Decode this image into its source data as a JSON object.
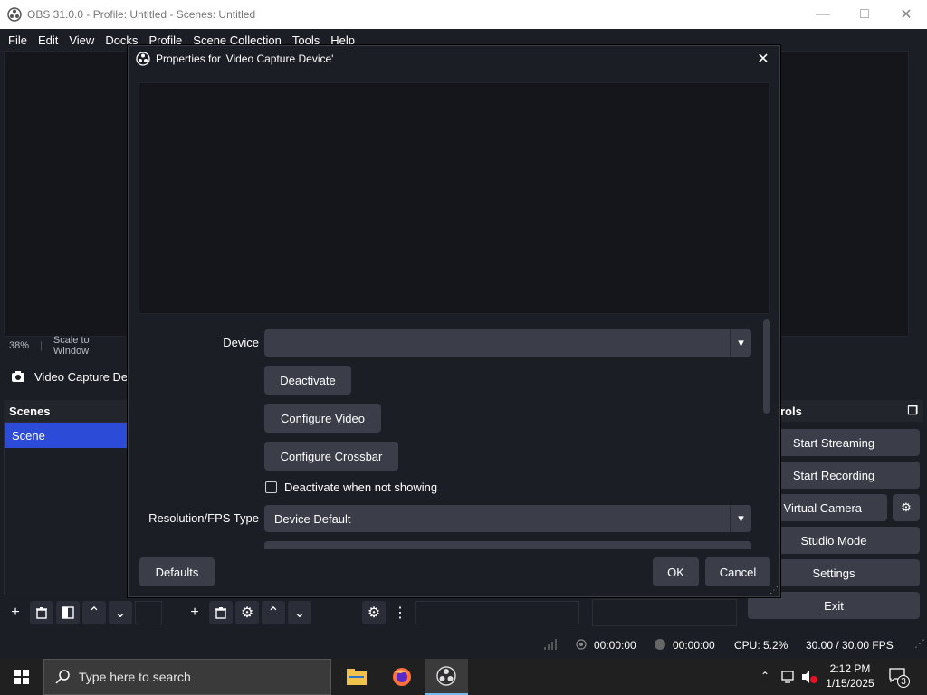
{
  "window": {
    "title": "OBS 31.0.0 - Profile: Untitled - Scenes: Untitled",
    "minimize_icon": "minimize-icon",
    "maximize_icon": "maximize-icon",
    "close_icon": "close-icon"
  },
  "menu": [
    "File",
    "Edit",
    "View",
    "Docks",
    "Profile",
    "Scene Collection",
    "Tools",
    "Help"
  ],
  "preview_bar": {
    "zoom": "38%",
    "scale_mode": "Scale to Window"
  },
  "source_bar": {
    "label": "Video Capture De"
  },
  "scenes": {
    "header": "Scenes",
    "items": [
      "Scene"
    ]
  },
  "controls": {
    "header_partial": "rols",
    "start_streaming": "Start Streaming",
    "start_recording": "Start Recording",
    "virtual_camera": "rt Virtual Camera",
    "studio_mode": "Studio Mode",
    "settings": "Settings",
    "exit": "Exit"
  },
  "status": {
    "stream_time": "00:00:00",
    "rec_time": "00:00:00",
    "cpu": "CPU: 5.2%",
    "fps": "30.00 / 30.00 FPS"
  },
  "taskbar": {
    "search_placeholder": "Type here to search",
    "time": "2:12 PM",
    "date": "1/15/2025",
    "notification_count": "3"
  },
  "dialog": {
    "title": "Properties for 'Video Capture Device'",
    "device_label": "Device",
    "device_value": "",
    "deactivate_button": "Deactivate",
    "configure_video_button": "Configure Video",
    "configure_crossbar_button": "Configure Crossbar",
    "deactivate_when_not_showing": "Deactivate when not showing",
    "deactivate_when_not_showing_checked": false,
    "resolution_label": "Resolution/FPS Type",
    "resolution_value": "Device Default",
    "defaults_button": "Defaults",
    "ok_button": "OK",
    "cancel_button": "Cancel"
  },
  "colors": {
    "accent_selected": "#2c4cd8",
    "panel_bg": "#1c1e25",
    "button_bg": "#3b3e49"
  }
}
